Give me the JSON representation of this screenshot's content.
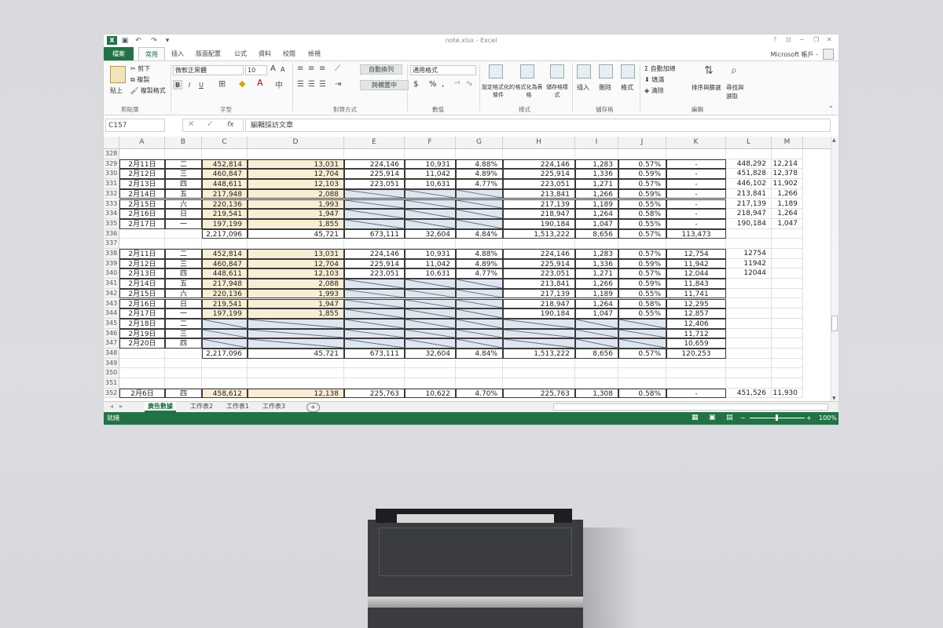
{
  "window": {
    "title": "note.xlsx - Excel",
    "help": "?",
    "account": "Microsoft 帳戶 -"
  },
  "tabs": [
    "檔案",
    "常用",
    "插入",
    "版面配置",
    "公式",
    "資料",
    "校閱",
    "檢視"
  ],
  "ribbon": {
    "clipboard": {
      "paste": "貼上",
      "cut": "剪下",
      "copy": "複製",
      "format_painter": "複製格式",
      "label": "剪貼簿"
    },
    "font": {
      "name": "微軟正黑體",
      "size": "10",
      "bold": "B",
      "italic": "I",
      "underline": "U",
      "grow": "A",
      "shrink": "A",
      "label": "字型"
    },
    "alignment": {
      "wrap": "自動換列",
      "merge": "跨欄置中",
      "label": "對齊方式"
    },
    "number": {
      "format": "通用格式",
      "currency": "$",
      "percent": "%",
      "comma": ",",
      "label": "數值"
    },
    "styles": {
      "conditional": "設定格式化的條件",
      "table": "格式化為表格",
      "cell": "儲存格樣式",
      "label": "樣式"
    },
    "cells": {
      "insert": "插入",
      "delete": "刪除",
      "format": "格式",
      "label": "儲存格"
    },
    "editing": {
      "autosum": "自動加總",
      "fill": "填滿",
      "clear": "清除",
      "sort": "排序與篩選",
      "find": "尋找與選取",
      "label": "編輯"
    }
  },
  "formula_bar": {
    "name_box": "C157",
    "fx": "fx",
    "formula": "編輯採訪文章"
  },
  "columns": [
    "A",
    "B",
    "C",
    "D",
    "E",
    "F",
    "G",
    "H",
    "I",
    "J",
    "K",
    "L",
    "M"
  ],
  "rows": [
    {
      "n": "328",
      "cells": {}
    },
    {
      "n": "329",
      "cells": {
        "A": "2月11日",
        "B": "二",
        "C": "452,814",
        "D": "13,031",
        "E": "224,146",
        "F": "10,931",
        "G": "4.88%",
        "H": "224,146",
        "I": "1,283",
        "J": "0.57%",
        "K": "-",
        "L": "448,292",
        "M": "12,214"
      }
    },
    {
      "n": "330",
      "cells": {
        "A": "2月12日",
        "B": "三",
        "C": "460,847",
        "D": "12,704",
        "E": "225,914",
        "F": "11,042",
        "G": "4.89%",
        "H": "225,914",
        "I": "1,336",
        "J": "0.59%",
        "K": "-",
        "L": "451,828",
        "M": "12,378"
      }
    },
    {
      "n": "331",
      "cells": {
        "A": "2月13日",
        "B": "四",
        "C": "448,611",
        "D": "12,103",
        "E": "223,051",
        "F": "10,631",
        "G": "4.77%",
        "H": "223,051",
        "I": "1,271",
        "J": "0.57%",
        "K": "-",
        "L": "446,102",
        "M": "11,902"
      }
    },
    {
      "n": "332",
      "cells": {
        "A": "2月14日",
        "B": "五",
        "C": "217,948",
        "D": "2,088",
        "H": "213,841",
        "I": "1,266",
        "J": "0.59%",
        "K": "-",
        "L": "213,841",
        "M": "1,266"
      }
    },
    {
      "n": "333",
      "cells": {
        "A": "2月15日",
        "B": "六",
        "C": "220,136",
        "D": "1,993",
        "H": "217,139",
        "I": "1,189",
        "J": "0.55%",
        "K": "-",
        "L": "217,139",
        "M": "1,189"
      }
    },
    {
      "n": "334",
      "cells": {
        "A": "2月16日",
        "B": "日",
        "C": "219,541",
        "D": "1,947",
        "H": "218,947",
        "I": "1,264",
        "J": "0.58%",
        "K": "-",
        "L": "218,947",
        "M": "1,264"
      }
    },
    {
      "n": "335",
      "cells": {
        "A": "2月17日",
        "B": "一",
        "C": "197,199",
        "D": "1,855",
        "H": "190,184",
        "I": "1,047",
        "J": "0.55%",
        "K": "-",
        "L": "190,184",
        "M": "1,047"
      }
    },
    {
      "n": "336",
      "cells": {
        "C": "2,217,096",
        "D": "45,721",
        "E": "673,111",
        "F": "32,604",
        "G": "4.84%",
        "H": "1,513,222",
        "I": "8,656",
        "J": "0.57%",
        "K": "113,473"
      }
    },
    {
      "n": "337",
      "cells": {}
    },
    {
      "n": "338",
      "cells": {
        "A": "2月11日",
        "B": "二",
        "C": "452,814",
        "D": "13,031",
        "E": "224,146",
        "F": "10,931",
        "G": "4.88%",
        "H": "224,146",
        "I": "1,283",
        "J": "0.57%",
        "K": "12,754",
        "L": "12754"
      }
    },
    {
      "n": "339",
      "cells": {
        "A": "2月12日",
        "B": "三",
        "C": "460,847",
        "D": "12,704",
        "E": "225,914",
        "F": "11,042",
        "G": "4.89%",
        "H": "225,914",
        "I": "1,336",
        "J": "0.59%",
        "K": "11,942",
        "L": "11942"
      }
    },
    {
      "n": "340",
      "cells": {
        "A": "2月13日",
        "B": "四",
        "C": "448,611",
        "D": "12,103",
        "E": "223,051",
        "F": "10,631",
        "G": "4.77%",
        "H": "223,051",
        "I": "1,271",
        "J": "0.57%",
        "K": "12,044",
        "L": "12044"
      }
    },
    {
      "n": "341",
      "cells": {
        "A": "2月14日",
        "B": "五",
        "C": "217,948",
        "D": "2,088",
        "H": "213,841",
        "I": "1,266",
        "J": "0.59%",
        "K": "11,843"
      }
    },
    {
      "n": "342",
      "cells": {
        "A": "2月15日",
        "B": "六",
        "C": "220,136",
        "D": "1,993",
        "H": "217,139",
        "I": "1,189",
        "J": "0.55%",
        "K": "11,741"
      }
    },
    {
      "n": "343",
      "cells": {
        "A": "2月16日",
        "B": "日",
        "C": "219,541",
        "D": "1,947",
        "H": "218,947",
        "I": "1,264",
        "J": "0.58%",
        "K": "12,295"
      }
    },
    {
      "n": "344",
      "cells": {
        "A": "2月17日",
        "B": "一",
        "C": "197,199",
        "D": "1,855",
        "H": "190,184",
        "I": "1,047",
        "J": "0.55%",
        "K": "12,857"
      }
    },
    {
      "n": "345",
      "cells": {
        "A": "2月18日",
        "B": "二",
        "K": "12,406"
      }
    },
    {
      "n": "346",
      "cells": {
        "A": "2月19日",
        "B": "三",
        "K": "11,712"
      }
    },
    {
      "n": "347",
      "cells": {
        "A": "2月20日",
        "B": "四",
        "K": "10,659"
      }
    },
    {
      "n": "348",
      "cells": {
        "C": "2,217,096",
        "D": "45,721",
        "E": "673,111",
        "F": "32,604",
        "G": "4.84%",
        "H": "1,513,222",
        "I": "8,656",
        "J": "0.57%",
        "K": "120,253"
      }
    },
    {
      "n": "349",
      "cells": {}
    },
    {
      "n": "350",
      "cells": {}
    },
    {
      "n": "351",
      "cells": {}
    },
    {
      "n": "352",
      "cells": {
        "A": "2月6日",
        "B": "四",
        "C": "458,612",
        "D": "12,138",
        "E": "225,763",
        "F": "10,622",
        "G": "4.70%",
        "H": "225,763",
        "I": "1,308",
        "J": "0.58%",
        "K": "-",
        "L": "451,526",
        "M": "11,930"
      }
    }
  ],
  "sheets": [
    "廣告數據",
    "工作表2",
    "工作表1",
    "工作表3"
  ],
  "add_sheet": "+",
  "status": {
    "ready": "就緒",
    "zoom": "100%"
  },
  "colors": {
    "excel_green": "#217346",
    "input_tan": "#f9edd3",
    "hatch_blue": "#dee6f0"
  }
}
